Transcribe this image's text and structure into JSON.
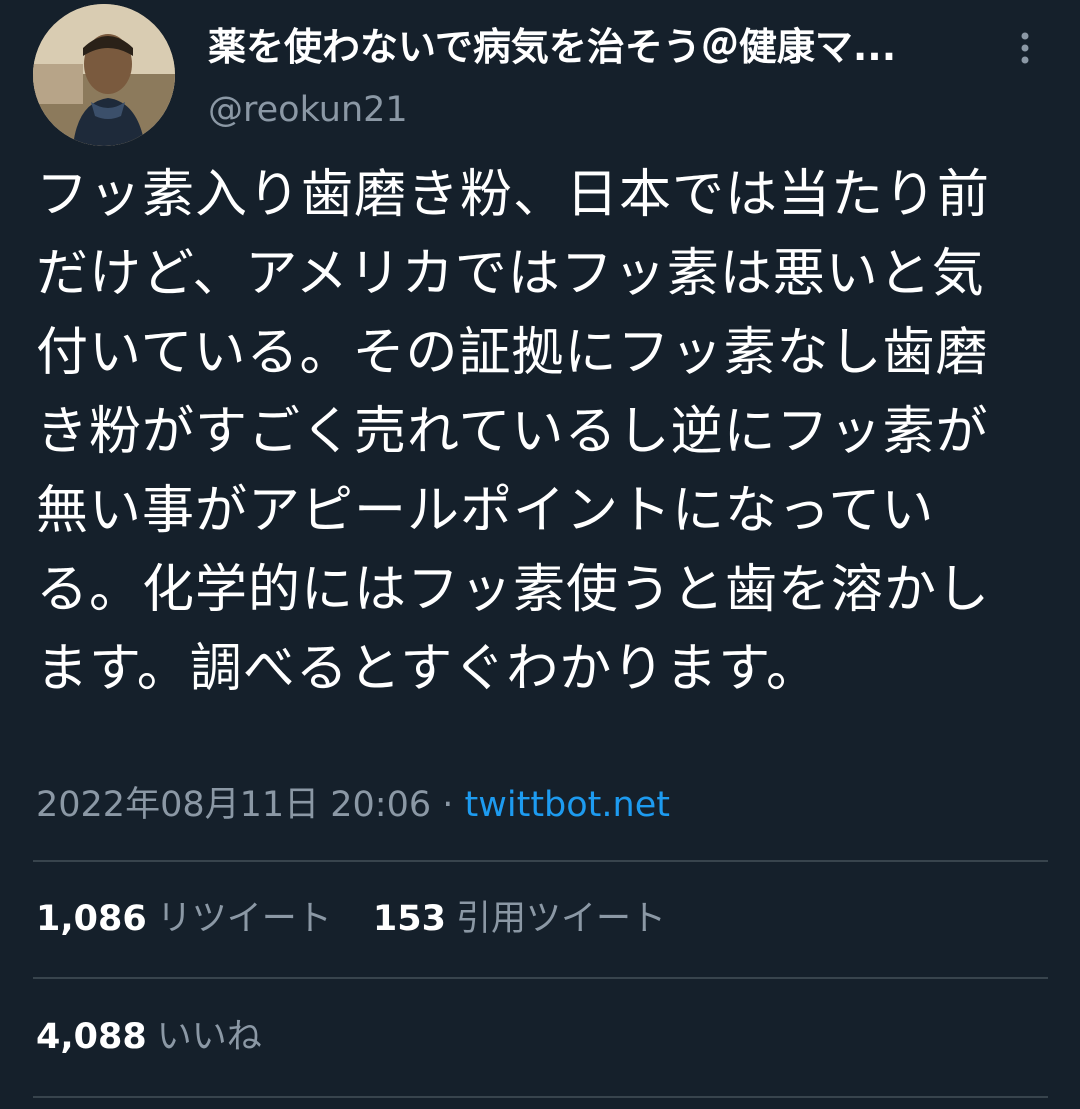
{
  "user": {
    "display_name": "薬を使わないで病気を治そう＠健康マ...",
    "handle": "@reokun21"
  },
  "tweet": {
    "text": "フッ素入り歯磨き粉、日本では当たり前だけど、アメリカではフッ素は悪いと気付いている。その証拠にフッ素なし歯磨き粉がすごく売れているし逆にフッ素が無い事がアピールポイントになっている。化学的にはフッ素使うと歯を溶かします。調べるとすぐわかります。",
    "timestamp": "2022年08月11日 20:06",
    "separator": " · ",
    "source": "twittbot.net"
  },
  "stats": {
    "retweets_count": "1,086",
    "retweets_label": "リツイート",
    "quotes_count": "153",
    "quotes_label": "引用ツイート",
    "likes_count": "4,088",
    "likes_label": "いいね"
  },
  "colors": {
    "background": "#15202b",
    "text_primary": "#ffffff",
    "text_secondary": "#8b98a5",
    "link": "#1d9bf0",
    "divider": "#38444d"
  },
  "icons": {
    "more": "more-vertical-icon",
    "avatar": "avatar"
  }
}
